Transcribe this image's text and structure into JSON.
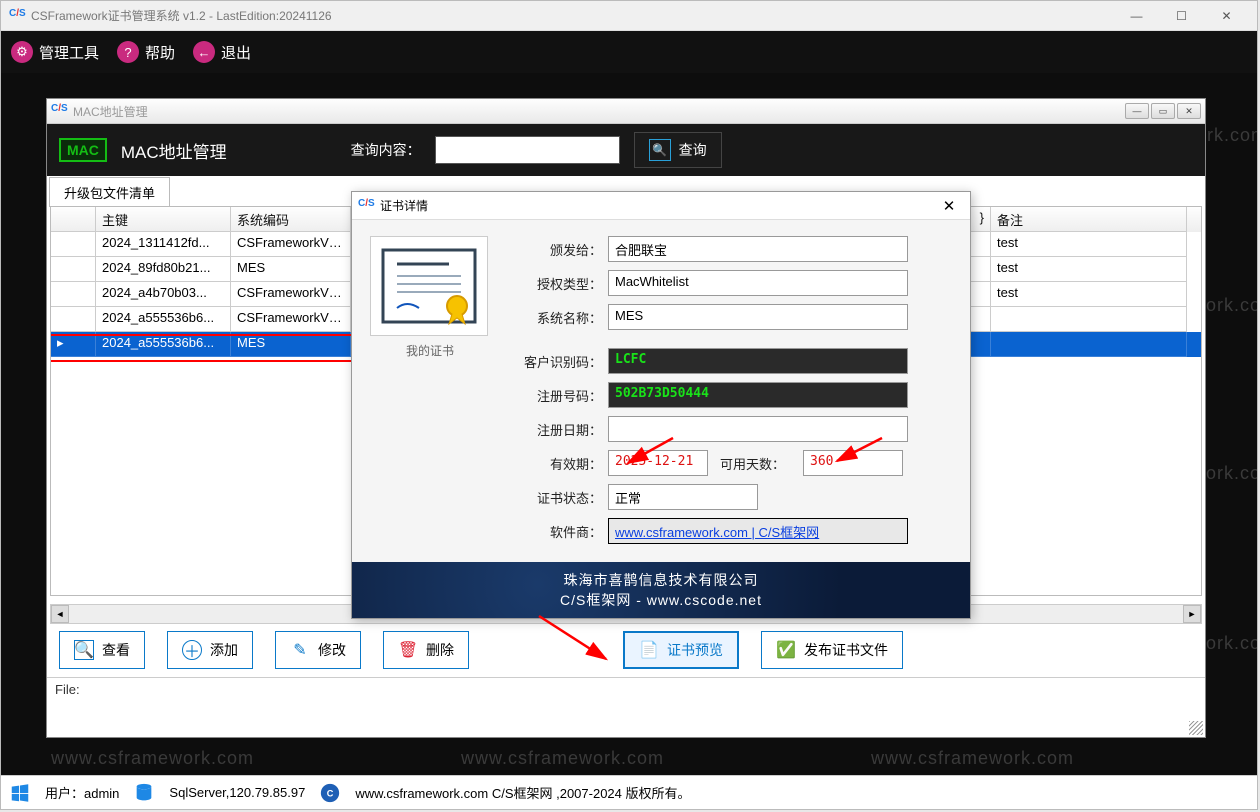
{
  "window": {
    "title": "CSFramework证书管理系统 v1.2 - LastEdition:20241126"
  },
  "menu": {
    "tools": "管理工具",
    "help": "帮助",
    "exit": "退出"
  },
  "child": {
    "title": "MAC地址管理",
    "header_title": "MAC地址管理",
    "search_label": "查询内容：",
    "query_btn": "查询",
    "tab": "升级包文件清单",
    "file_label": "File:"
  },
  "grid": {
    "headers": {
      "key": "主键",
      "sys": "系统编码",
      "note": "备注"
    },
    "rows": [
      {
        "key": "2024_1311412fd...",
        "sys": "CSFrameworkV6...",
        "note": "test"
      },
      {
        "key": "2024_89fd80b21...",
        "sys": "MES",
        "note": "test"
      },
      {
        "key": "2024_a4b70b03...",
        "sys": "CSFrameworkV6...",
        "note": "test"
      },
      {
        "key": "2024_a555536b6...",
        "sys": "CSFrameworkV6...",
        "note": ""
      },
      {
        "key": "2024_a555536b6...",
        "sys": "MES",
        "note": ""
      }
    ]
  },
  "actions": {
    "view": "查看",
    "add": "添加",
    "edit": "修改",
    "del": "删除",
    "preview": "证书预览",
    "publish": "发布证书文件"
  },
  "dialog": {
    "title": "证书详情",
    "caption": "我的证书",
    "labels": {
      "issued_to": "颁发给：",
      "auth_type": "授权类型：",
      "sys_name": "系统名称：",
      "cust_id": "客户识别码：",
      "reg_no": "注册号码：",
      "reg_date": "注册日期：",
      "expire": "有效期：",
      "days_left": "可用天数：",
      "status": "证书状态：",
      "vendor": "软件商："
    },
    "values": {
      "issued_to": "合肥联宝",
      "auth_type": "MacWhitelist",
      "sys_name": "MES",
      "cust_id": "LCFC",
      "reg_no": "502B73D50444",
      "reg_date": "",
      "expire": "2025-12-21",
      "days_left": "360",
      "status": "正常",
      "vendor": "www.csframework.com | C/S框架网"
    },
    "footer1": "珠海市喜鹊信息技术有限公司",
    "footer2": "C/S框架网 - www.cscode.net"
  },
  "statusbar": {
    "user": "用户：admin",
    "db": "SqlServer,120.79.85.97",
    "site": "www.csframework.com C/S框架网 ,2007-2024 版权所有。"
  },
  "watermark": "www.csframework.com"
}
